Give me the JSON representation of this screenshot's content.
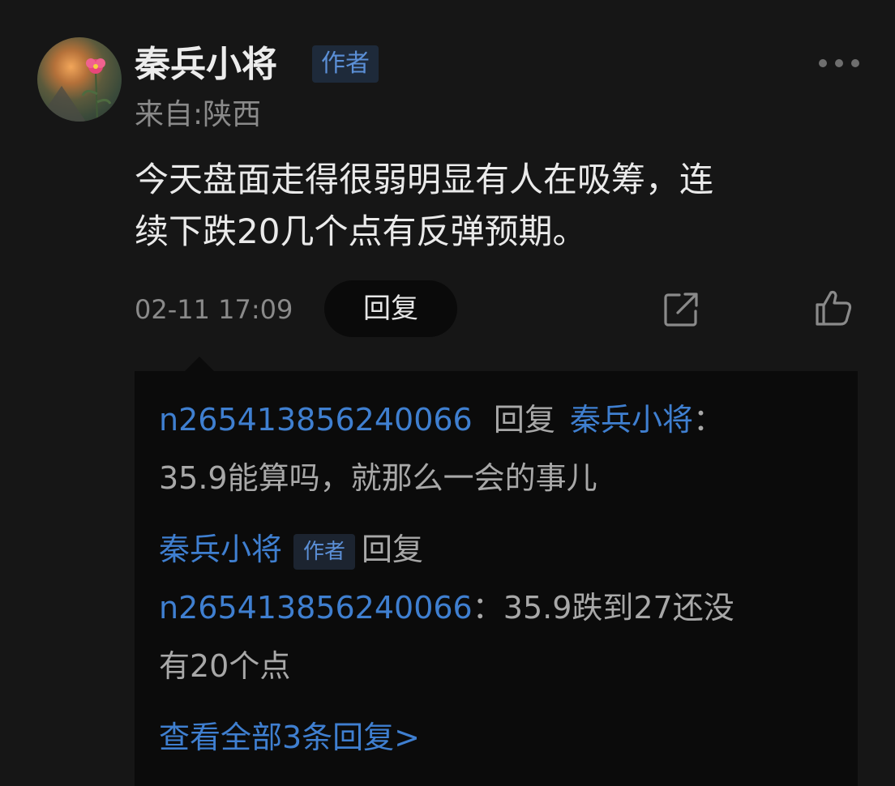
{
  "post": {
    "username": "秦兵小将",
    "author_tag": "作者",
    "location": "来自:陕西",
    "content_line1": "今天盘面走得很弱明显有人在吸筹，连",
    "content_line2": "续下跌20几个点有反弹预期。",
    "timestamp": "02-11 17:09",
    "reply_button": "回复"
  },
  "replies": {
    "r1_user": "n265413856240066",
    "r1_reply_word": "回复",
    "r1_target": "秦兵小将",
    "r1_colon": "：",
    "r1_text": "35.9能算吗，就那么一会的事儿",
    "r2_user": "秦兵小将",
    "r2_tag": "作者",
    "r2_reply_word": "回复",
    "r2_target": "n265413856240066",
    "r2_colon": "：",
    "r2_text1": "35.9跌到27还没",
    "r2_text2": "有20个点",
    "view_all": "查看全部3条回复>"
  },
  "icons": {
    "more": "more-icon",
    "share": "share-icon",
    "like": "thumbs-up-icon"
  },
  "colors": {
    "background": "#161616",
    "reply_box": "#0b0b0b",
    "link_blue": "#3f7fd0",
    "tag_text": "#5b8fd6"
  }
}
